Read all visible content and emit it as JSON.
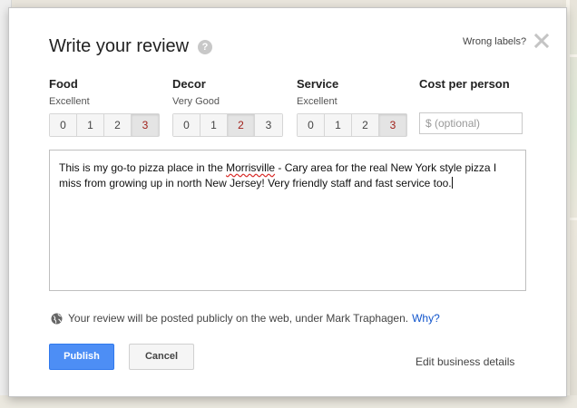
{
  "dialog": {
    "title": "Write your review",
    "help_icon": "question-icon",
    "wrong_labels": "Wrong labels?",
    "close_icon": "close-x-icon"
  },
  "categories": [
    {
      "title": "Food",
      "rating_label": "Excellent",
      "options": [
        "0",
        "1",
        "2",
        "3"
      ],
      "selected": "3"
    },
    {
      "title": "Decor",
      "rating_label": "Very Good",
      "options": [
        "0",
        "1",
        "2",
        "3"
      ],
      "selected": "2"
    },
    {
      "title": "Service",
      "rating_label": "Excellent",
      "options": [
        "0",
        "1",
        "2",
        "3"
      ],
      "selected": "3"
    }
  ],
  "cost": {
    "title": "Cost per person",
    "placeholder": "$ (optional)"
  },
  "review": {
    "text_part1": "This is my go-to pizza place in the ",
    "text_misspelled": "Morrisville",
    "text_part2": " - Cary area for the real New York style pizza I miss from growing up in north New Jersey! Very friendly staff and fast service too."
  },
  "notice": {
    "icon": "globe-icon",
    "text": "Your review will be posted publicly on the web, under Mark Traphagen.",
    "link": "Why?"
  },
  "actions": {
    "publish": "Publish",
    "cancel": "Cancel",
    "edit_business": "Edit business details"
  },
  "colors": {
    "publish_bg": "#4d8ef5",
    "selected_rating_text": "#a1211b",
    "link": "#1155cc"
  }
}
